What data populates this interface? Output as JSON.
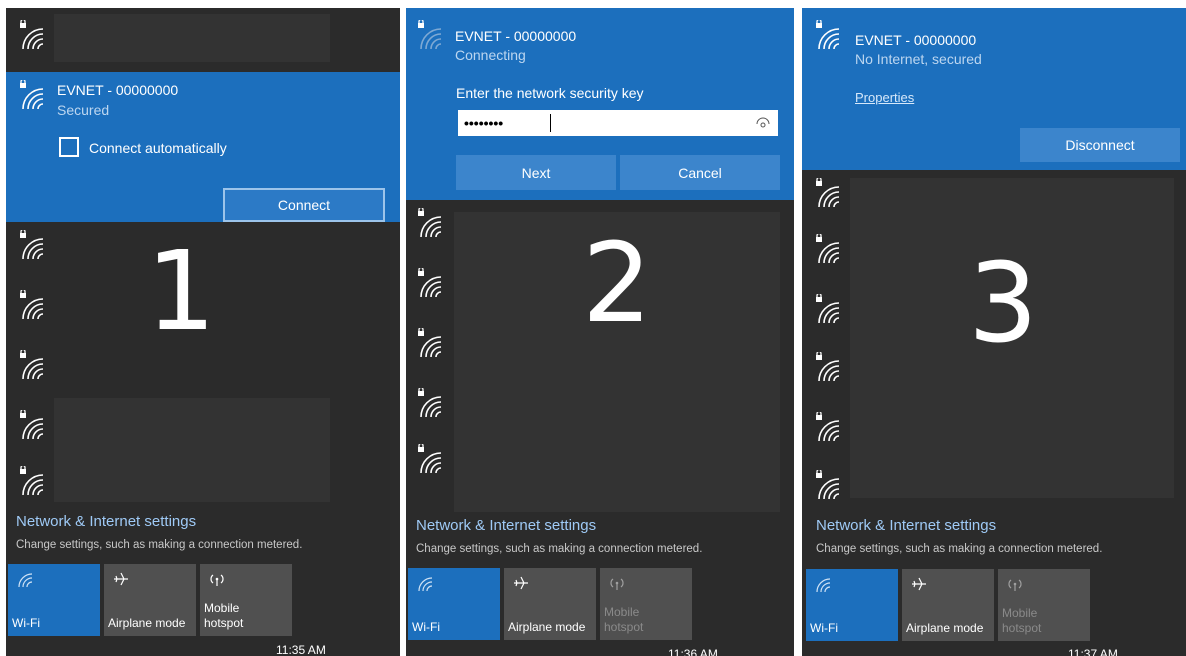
{
  "panels": [
    {
      "number": "1",
      "network": {
        "ssid": "EVNET - 00000000",
        "status": "Secured",
        "checkbox_label": "Connect automatically",
        "connect_label": "Connect"
      },
      "settings_title": "Network & Internet settings",
      "settings_sub": "Change settings, such as making a connection metered.",
      "tiles": {
        "wifi": "Wi-Fi",
        "airplane": "Airplane mode",
        "hotspot_1": "Mobile",
        "hotspot_2": "hotspot"
      },
      "clock": "11:35 AM"
    },
    {
      "number": "2",
      "network": {
        "ssid": "EVNET - 00000000",
        "status": "Connecting",
        "key_prompt": "Enter the network security key",
        "key_value": "••••••••",
        "next_label": "Next",
        "cancel_label": "Cancel"
      },
      "settings_title": "Network & Internet settings",
      "settings_sub": "Change settings, such as making a connection metered.",
      "tiles": {
        "wifi": "Wi-Fi",
        "airplane": "Airplane mode",
        "hotspot_1": "Mobile",
        "hotspot_2": "hotspot"
      },
      "clock": "11:36 AM"
    },
    {
      "number": "3",
      "network": {
        "ssid": "EVNET - 00000000",
        "status": "No Internet, secured",
        "properties_label": "Properties",
        "disconnect_label": "Disconnect"
      },
      "settings_title": "Network & Internet settings",
      "settings_sub": "Change settings, such as making a connection metered.",
      "tiles": {
        "wifi": "Wi-Fi",
        "airplane": "Airplane mode",
        "hotspot_1": "Mobile",
        "hotspot_2": "hotspot"
      },
      "clock": "11:37 AM"
    }
  ],
  "colors": {
    "accent": "#1c6fbd",
    "panel_bg": "#2b2b2b",
    "tile_bg": "#505050",
    "link": "#9fcaf6"
  },
  "icons": {
    "wifi": "wifi-secured-icon",
    "airplane": "airplane-icon",
    "hotspot": "mobile-hotspot-icon",
    "eye": "reveal-password-icon"
  }
}
